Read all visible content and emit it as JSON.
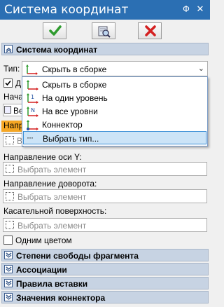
{
  "window": {
    "title": "Система координат",
    "pin_glyph": "Ф",
    "close_glyph": "✕"
  },
  "toolbar": {
    "ok_icon": "checkmark-icon",
    "preview_icon": "preview-icon",
    "cancel_icon": "cancel-icon"
  },
  "sections": {
    "coord_system": "Система координат",
    "freedom": "Степени свободы фрагмента",
    "associations": "Ассоциации",
    "insert_rules": "Правила вставки",
    "connector_values": "Значения коннектора"
  },
  "type_field": {
    "label": "Тип:",
    "value": "Скрыть в сборке"
  },
  "partially_hidden": {
    "checkbox_label": "Д",
    "origin_label": "Начал",
    "origin_button": "Ве",
    "direction_x_label": "Напра",
    "direction_x_placeholder": "Вы"
  },
  "dropdown": {
    "items": [
      {
        "label": "Скрыть в сборке",
        "icon": "axes-icon"
      },
      {
        "label": "На один уровень",
        "icon": "axes-one-level-icon"
      },
      {
        "label": "На все уровни",
        "icon": "axes-all-levels-icon"
      },
      {
        "label": "Коннектор",
        "icon": "connector-icon"
      },
      {
        "label": "Выбрать тип...",
        "icon": "ellipsis-icon"
      }
    ],
    "selected_index": 4
  },
  "fields": {
    "axis_y_label": "Направление оси Y:",
    "axis_y_placeholder": "Выбрать элемент",
    "rotation_label": "Направление доворота:",
    "rotation_placeholder": "Выбрать элемент",
    "tangent_label": "Касательной поверхность:",
    "tangent_placeholder": "Выбрать элемент"
  },
  "one_color": {
    "label": "Одним цветом",
    "checked": false
  },
  "colors": {
    "title_bar": "#2b6fb3",
    "section_header": "#c7d3e3",
    "ok_green": "#2e9b2e",
    "cancel_red": "#d42020",
    "selection": "#cce4f7",
    "orange_label": "#f5a623"
  }
}
